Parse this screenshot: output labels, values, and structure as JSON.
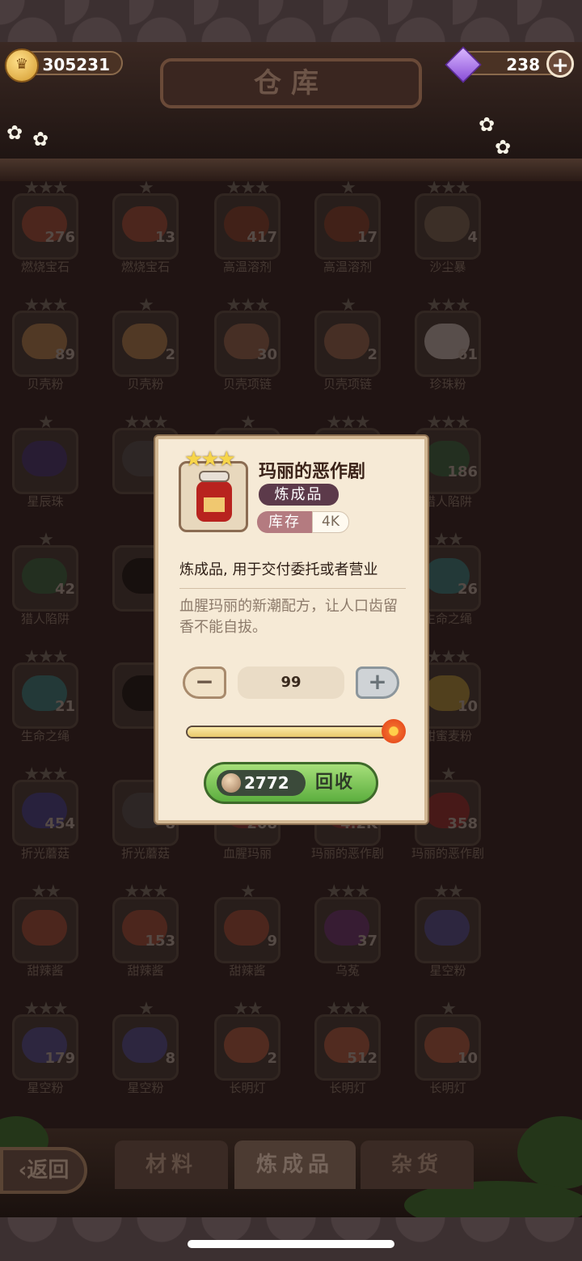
{
  "header": {
    "title": "仓库",
    "coins": "305231",
    "gems": "238",
    "plus_label": "+"
  },
  "icons": [
    "crown-coin-icon",
    "purple-gem-icon",
    "plus-icon",
    "back-arrow-icon",
    "star-icon",
    "flower-icon",
    "jam-jar-icon",
    "coin-icon"
  ],
  "colors": {
    "popup_bg": "#f6ead6",
    "category_badge": "#5c3a4a",
    "stock_badge": "#b47b80",
    "recycle_button": "#5cae3e",
    "star_gold": "#f7d54a"
  },
  "inventory": [
    {
      "name": "燃烧宝石",
      "count": "276",
      "stars": "★★★"
    },
    {
      "name": "燃烧宝石",
      "count": "13",
      "stars": "★"
    },
    {
      "name": "高温溶剂",
      "count": "417",
      "stars": "★★★"
    },
    {
      "name": "高温溶剂",
      "count": "17",
      "stars": "★"
    },
    {
      "name": "沙尘暴",
      "count": "4",
      "stars": "★★★"
    },
    {
      "name": "贝壳粉",
      "count": "89",
      "stars": "★★★"
    },
    {
      "name": "贝壳粉",
      "count": "2",
      "stars": "★"
    },
    {
      "name": "贝壳项链",
      "count": "30",
      "stars": "★★★"
    },
    {
      "name": "贝壳项链",
      "count": "2",
      "stars": "★"
    },
    {
      "name": "珍珠粉",
      "count": "61",
      "stars": "★★★"
    },
    {
      "name": "星辰珠",
      "count": "",
      "stars": "★"
    },
    {
      "name": "",
      "count": "",
      "stars": "★★★"
    },
    {
      "name": "",
      "count": "",
      "stars": "★"
    },
    {
      "name": "",
      "count": "",
      "stars": "★★★"
    },
    {
      "name": "猎人陷阱",
      "count": "186",
      "stars": "★★★"
    },
    {
      "name": "猎人陷阱",
      "count": "42",
      "stars": "★"
    },
    {
      "name": "",
      "count": "",
      "stars": ""
    },
    {
      "name": "",
      "count": "",
      "stars": ""
    },
    {
      "name": "",
      "count": "",
      "stars": ""
    },
    {
      "name": "生命之绳",
      "count": "26",
      "stars": "★★"
    },
    {
      "name": "生命之绳",
      "count": "21",
      "stars": "★★★"
    },
    {
      "name": "",
      "count": "",
      "stars": ""
    },
    {
      "name": "",
      "count": "",
      "stars": ""
    },
    {
      "name": "",
      "count": "",
      "stars": ""
    },
    {
      "name": "甜蜜麦粉",
      "count": "10",
      "stars": "★★★"
    },
    {
      "name": "折光蘑菇",
      "count": "454",
      "stars": "★★★"
    },
    {
      "name": "折光蘑菇",
      "count": "8",
      "stars": ""
    },
    {
      "name": "血腥玛丽",
      "count": "208",
      "stars": ""
    },
    {
      "name": "玛丽的恶作剧",
      "count": "4.2K",
      "stars": ""
    },
    {
      "name": "玛丽的恶作剧",
      "count": "358",
      "stars": "★"
    },
    {
      "name": "甜辣酱",
      "count": "",
      "stars": "★★"
    },
    {
      "name": "甜辣酱",
      "count": "153",
      "stars": "★★★"
    },
    {
      "name": "甜辣酱",
      "count": "9",
      "stars": "★"
    },
    {
      "name": "乌菟",
      "count": "37",
      "stars": "★★★"
    },
    {
      "name": "星空粉",
      "count": "",
      "stars": "★★"
    },
    {
      "name": "星空粉",
      "count": "179",
      "stars": "★★★"
    },
    {
      "name": "星空粉",
      "count": "8",
      "stars": "★"
    },
    {
      "name": "长明灯",
      "count": "2",
      "stars": "★★"
    },
    {
      "name": "长明灯",
      "count": "512",
      "stars": "★★★"
    },
    {
      "name": "长明灯",
      "count": "10",
      "stars": "★"
    }
  ],
  "popup": {
    "stars": "★★★",
    "title": "玛丽的恶作剧",
    "category": "炼成品",
    "stock_label": "库存",
    "stock_value": "4K",
    "description": "炼成品, 用于交付委托或者营业",
    "flavor": "血腥玛丽的新潮配方，让人口齿留香不能自拔。",
    "minus_label": "−",
    "quantity": "99",
    "plus_label": "+",
    "slider_level": 1.0,
    "price": "2772",
    "recycle_label": "回收"
  },
  "tabs": [
    {
      "label": "材料"
    },
    {
      "label": "炼成品"
    },
    {
      "label": "杂货"
    }
  ],
  "back_label": "‹返回"
}
